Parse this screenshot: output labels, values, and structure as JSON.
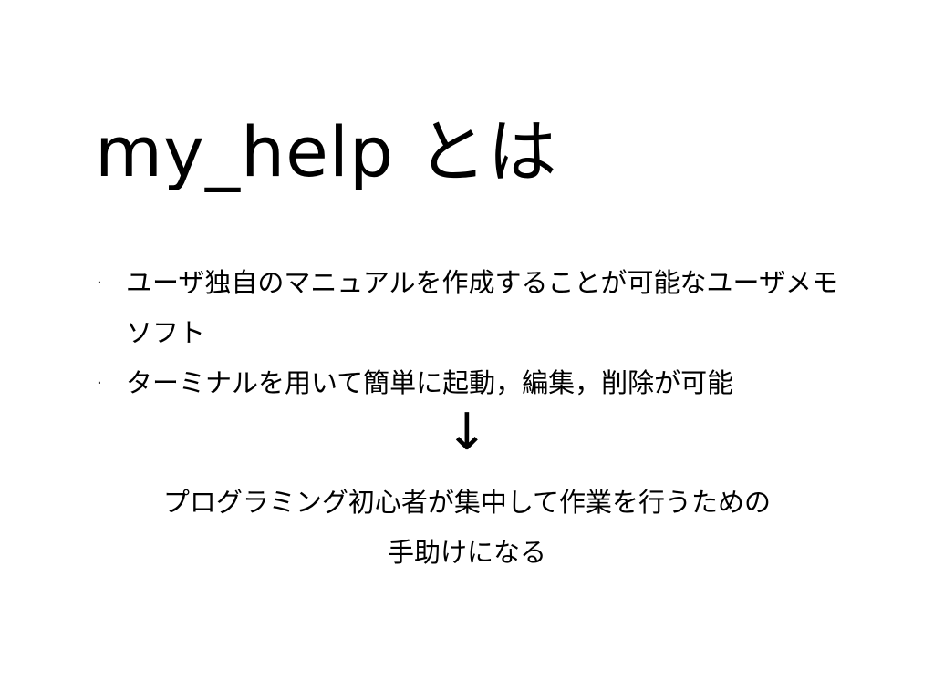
{
  "slide": {
    "title": "my_help とは",
    "bullets": [
      {
        "marker": "·",
        "text": "ユーザ独自のマニュアルを作成することが可能なユーザメモソフト"
      },
      {
        "marker": "·",
        "text": "ターミナルを用いて簡単に起動，編集，削除が可能"
      }
    ],
    "arrow": "↓",
    "conclusion_lines": [
      "プログラミング初心者が集中して作業を行うための",
      "手助けになる"
    ]
  }
}
